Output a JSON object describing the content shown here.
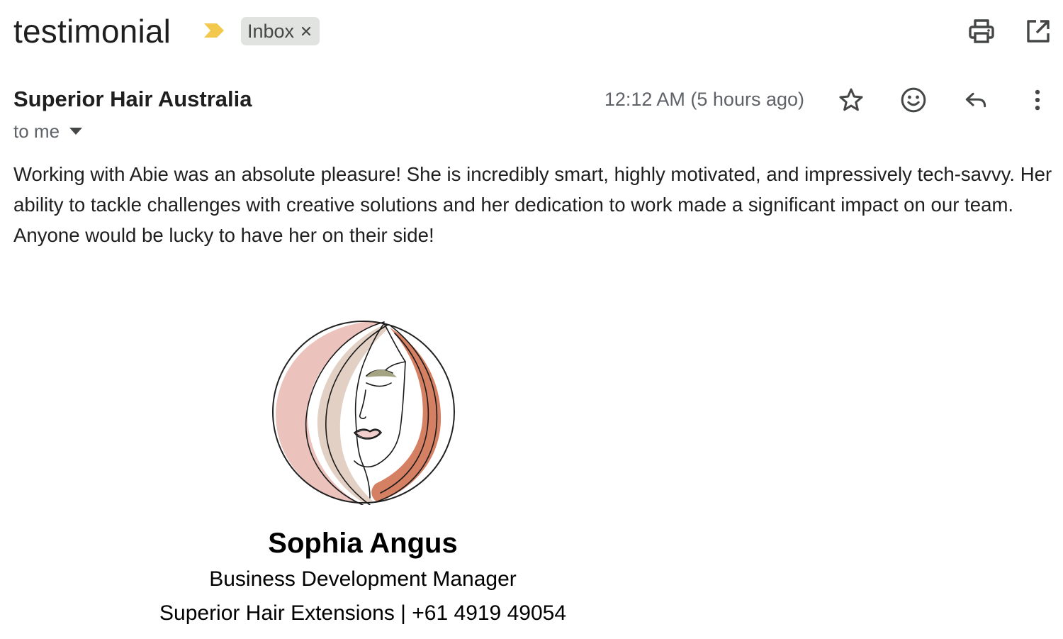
{
  "email": {
    "subject": "testimonial",
    "label": {
      "text": "Inbox",
      "close_glyph": "×"
    },
    "sender_name": "Superior Hair Australia",
    "recipient_text": "to me",
    "timestamp": "12:12 AM (5 hours ago)",
    "body": "Working with Abie was an absolute pleasure! She is incredibly smart, highly motivated, and impressively tech-savvy. Her ability to tackle challenges with creative solutions and her dedication to work made a significant impact on our team. Anyone would be lucky to have her on their side!"
  },
  "signature": {
    "name": "Sophia Angus",
    "title": "Business Development Manager",
    "company_phone": "Superior Hair Extensions | +61 4919 49054"
  },
  "icons": {
    "importance": "importance-marker-icon",
    "print": "print-icon",
    "open_new_window": "open-in-new-window-icon",
    "star": "star-icon",
    "emoji": "emoji-reaction-icon",
    "reply": "reply-icon",
    "more": "more-vertical-icon",
    "recipient_details": "chevron-down-icon"
  },
  "colors": {
    "importance": "#f2c94c",
    "chip_bg": "#e1e3e1",
    "secondary_text": "#5f6368",
    "logo_pink": "#ecc2bc",
    "logo_beige": "#e2d0c4",
    "logo_terracotta": "#d57f63",
    "logo_olive": "#a4a382"
  }
}
